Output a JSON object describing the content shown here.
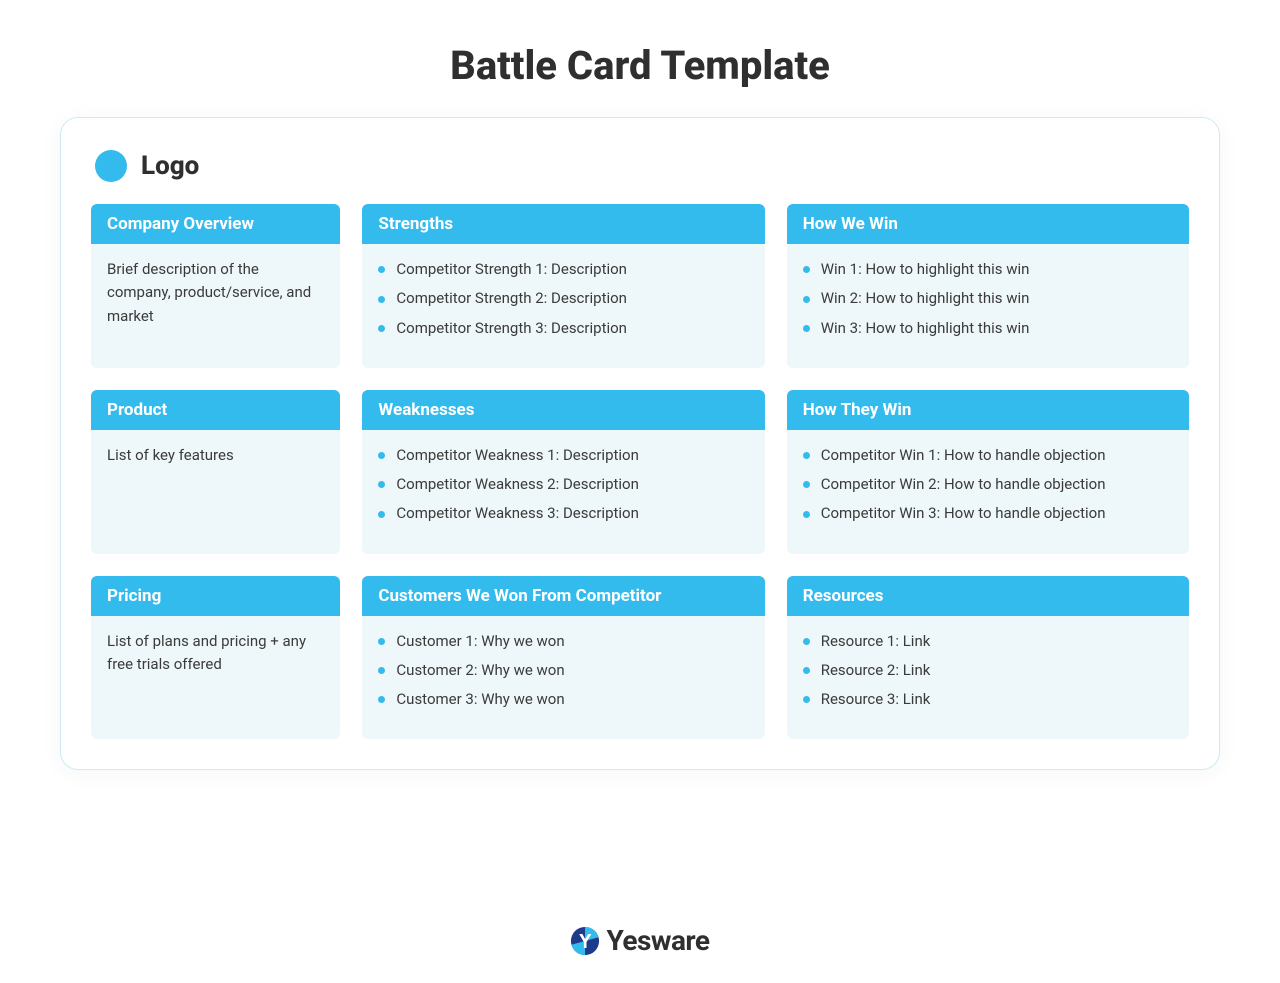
{
  "title": "Battle Card Template",
  "logo_label": "Logo",
  "brand_name": "Yesware",
  "columns": {
    "c1": {
      "r1": {
        "header": "Company Overview",
        "text": "Brief description of the company, product/service, and market"
      },
      "r2": {
        "header": "Product",
        "text": "List of key features"
      },
      "r3": {
        "header": "Pricing",
        "text": "List of plans and pricing + any free trials offered"
      }
    },
    "c2": {
      "r1": {
        "header": "Strengths",
        "items": [
          "Competitor Strength 1: Description",
          "Competitor Strength 2: Description",
          "Competitor Strength 3: Description"
        ]
      },
      "r2": {
        "header": "Weaknesses",
        "items": [
          "Competitor Weakness 1: Description",
          "Competitor Weakness 2: Description",
          "Competitor Weakness 3: Description"
        ]
      },
      "r3": {
        "header": "Customers We Won From Competitor",
        "items": [
          "Customer 1: Why we won",
          "Customer 2: Why we won",
          "Customer 3: Why we won"
        ]
      }
    },
    "c3": {
      "r1": {
        "header": "How We Win",
        "items": [
          "Win 1: How to highlight this win",
          "Win 2: How to highlight this win",
          "Win 3: How to highlight this win"
        ]
      },
      "r2": {
        "header": "How They Win",
        "items": [
          "Competitor Win 1: How to handle objection",
          "Competitor Win 2: How to handle objection",
          "Competitor Win 3: How to handle objection"
        ]
      },
      "r3": {
        "header": "Resources",
        "items": [
          "Resource 1: Link",
          "Resource 2: Link",
          "Resource 3: Link"
        ]
      }
    }
  }
}
